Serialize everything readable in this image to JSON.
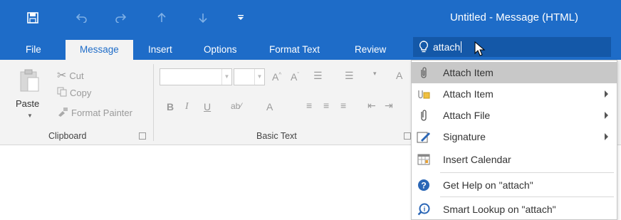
{
  "window": {
    "title": "Untitled  -  Message (HTML)"
  },
  "qat": {
    "save_icon": "save-icon",
    "undo_icon": "undo-icon",
    "redo_icon": "redo-icon",
    "up_icon": "up-arrow-icon",
    "down_icon": "down-arrow-icon",
    "customize_icon": "customize-qat-icon"
  },
  "tabs": [
    {
      "label": "File"
    },
    {
      "label": "Message"
    },
    {
      "label": "Insert"
    },
    {
      "label": "Options"
    },
    {
      "label": "Format Text"
    },
    {
      "label": "Review"
    }
  ],
  "tellme": {
    "value": "attach",
    "icon": "lightbulb-icon"
  },
  "ribbon": {
    "clipboard": {
      "paste_label": "Paste",
      "cut_label": "Cut",
      "copy_label": "Copy",
      "format_painter_label": "Format Painter",
      "group_label": "Clipboard"
    },
    "basic_text": {
      "group_label": "Basic Text",
      "bold": "B",
      "italic": "I",
      "underline": "U",
      "font_color": "A"
    }
  },
  "menu": {
    "items": [
      {
        "label": "Attach Item",
        "icon": "paperclip-icon",
        "highlighted": true,
        "submenu": false
      },
      {
        "label": "Attach Item",
        "icon": "attach-item-icon",
        "highlighted": false,
        "submenu": true
      },
      {
        "label": "Attach File",
        "icon": "paperclip-icon",
        "highlighted": false,
        "submenu": true
      },
      {
        "label": "Signature",
        "icon": "signature-icon",
        "highlighted": false,
        "submenu": true
      },
      {
        "label": "Insert Calendar",
        "icon": "calendar-icon",
        "highlighted": false,
        "submenu": false
      },
      {
        "label": "Get Help on \"attach\"",
        "icon": "help-icon",
        "highlighted": false,
        "submenu": false
      },
      {
        "label": "Smart Lookup on \"attach\"",
        "icon": "smart-lookup-icon",
        "highlighted": false,
        "submenu": false
      }
    ]
  },
  "colors": {
    "accent": "#1e6cc8",
    "tellme_bg": "#1458a8",
    "ribbon_bg": "#f3f3f3",
    "highlight": "#c8c8c8"
  }
}
